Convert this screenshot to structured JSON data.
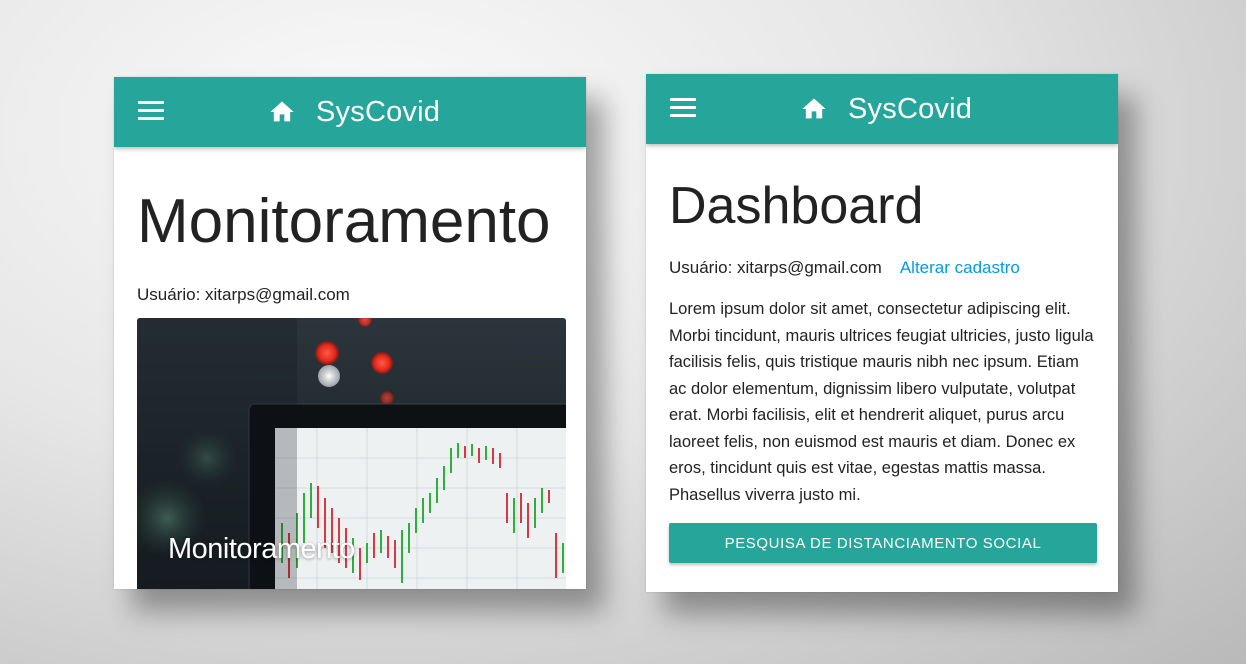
{
  "brand_color": "#26a69a",
  "link_color": "#039be5",
  "screen_monitoramento": {
    "appbar": {
      "menu_icon": "hamburger-menu-icon",
      "home_icon": "home-icon",
      "brand": "SysCovid"
    },
    "title": "Monitoramento",
    "user": "Usuário: xitarps@gmail.com",
    "card": {
      "image": "stock-chart-on-laptop-photo",
      "title": "Monitoramento"
    }
  },
  "screen_dashboard": {
    "appbar": {
      "menu_icon": "hamburger-menu-icon",
      "home_icon": "home-icon",
      "brand": "SysCovid"
    },
    "title": "Dashboard",
    "user": "Usuário: xitarps@gmail.com",
    "alter_link": "Alterar cadastro",
    "paragraph": "Lorem ipsum dolor sit amet, consectetur adipiscing elit. Morbi tincidunt, mauris ultrices feugiat ultricies, justo ligula facilisis felis, quis tristique mauris nibh nec ipsum. Etiam ac dolor elementum, dignissim libero vulputate, volutpat erat. Morbi facilisis, elit et hendrerit aliquet, purus arcu laoreet felis, non euismod est mauris et diam. Donec ex eros, tincidunt quis est vitae, egestas mattis massa. Phasellus viverra justo mi.",
    "button": "PESQUISA DE DISTANCIAMENTO SOCIAL"
  }
}
